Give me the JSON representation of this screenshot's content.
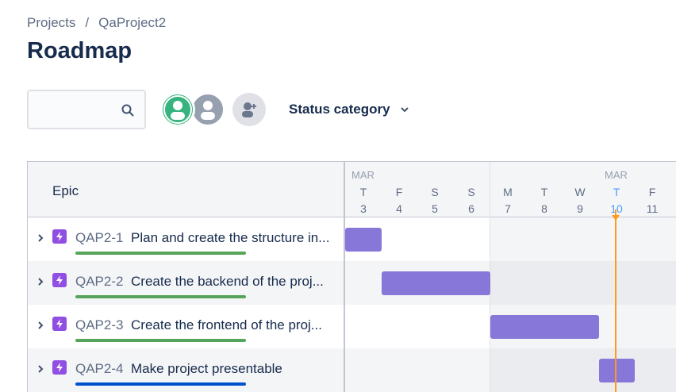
{
  "breadcrumb": {
    "projects": "Projects",
    "separator": "/",
    "project": "QaProject2"
  },
  "page_title": "Roadmap",
  "search": {
    "value": "",
    "placeholder": ""
  },
  "filters": {
    "status_category": "Status category"
  },
  "roadmap": {
    "epic_header": "Epic",
    "months": [
      "MAR",
      "MAR"
    ],
    "days": [
      {
        "letter": "T",
        "num": "3"
      },
      {
        "letter": "F",
        "num": "4"
      },
      {
        "letter": "S",
        "num": "5"
      },
      {
        "letter": "S",
        "num": "6"
      },
      {
        "letter": "M",
        "num": "7"
      },
      {
        "letter": "T",
        "num": "8"
      },
      {
        "letter": "W",
        "num": "9"
      },
      {
        "letter": "T",
        "num": "10"
      },
      {
        "letter": "F",
        "num": "11"
      }
    ],
    "today_day": "10",
    "epics": [
      {
        "key": "QAP2-1",
        "summary": "Plan and create the structure in...",
        "progress_color": "#57a55a",
        "start_day": "3",
        "end_day": "3"
      },
      {
        "key": "QAP2-2",
        "summary": "Create the backend of the proj...",
        "progress_color": "#57a55a",
        "start_day": "4",
        "end_day": "6"
      },
      {
        "key": "QAP2-3",
        "summary": "Create the frontend of the proj...",
        "progress_color": "#57a55a",
        "start_day": "7",
        "end_day": "9"
      },
      {
        "key": "QAP2-4",
        "summary": "Make project presentable",
        "progress_color": "#0052cc",
        "start_day": "10",
        "end_day": "10"
      }
    ]
  },
  "colors": {
    "bar": "#8777d9",
    "today_line": "#ff991f",
    "epic_icon": "#904ee2",
    "avatar_green": "#36b37e",
    "avatar_gray": "#97a0af"
  }
}
